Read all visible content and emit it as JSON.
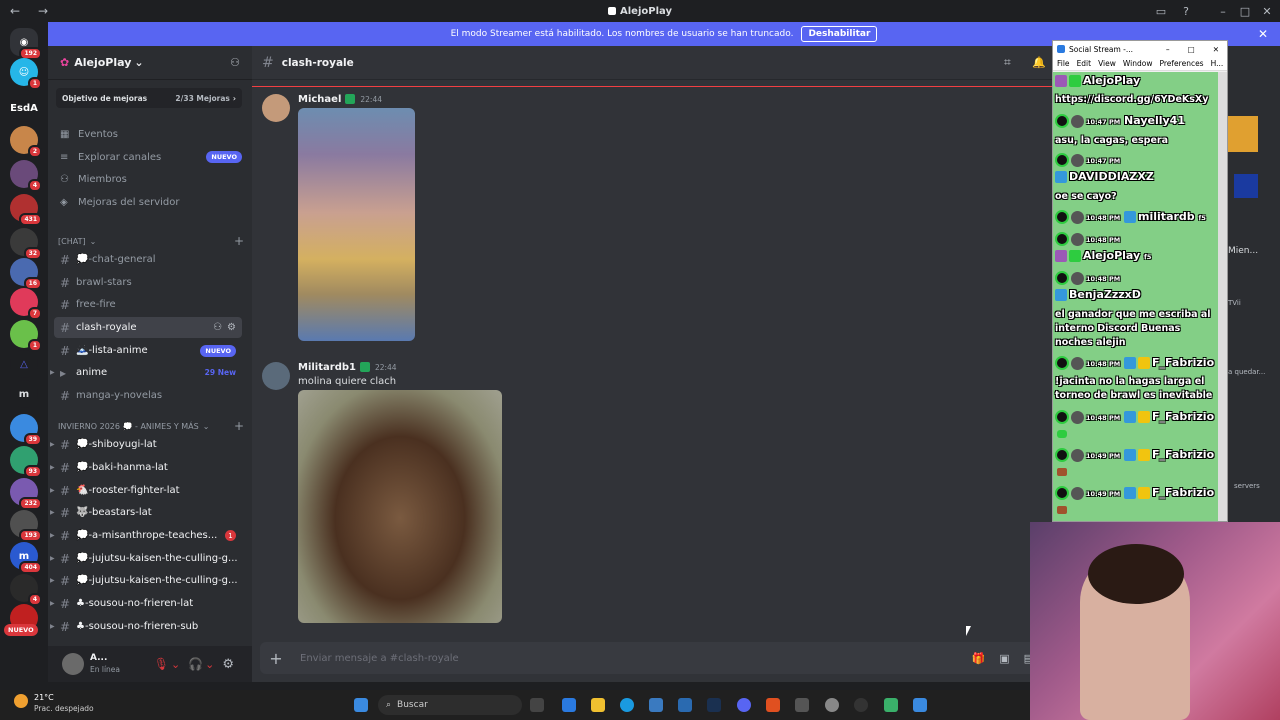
{
  "window": {
    "title": "AlejoPlay"
  },
  "banner": {
    "text": "El modo Streamer está habilitado. Los nombres de usuario se han truncado.",
    "button": "Deshabilitar"
  },
  "rail": {
    "badges": [
      "192",
      "1",
      "2",
      "4",
      "431",
      "32",
      "16",
      "7",
      "1",
      "39",
      "93",
      "232",
      "193",
      "404",
      "4"
    ],
    "esda": "EsdA",
    "m": "m",
    "nuevo": "NUEVO"
  },
  "guild": {
    "name": "AlejoPlay"
  },
  "boost": {
    "label": "Objetivo de mejoras",
    "count": "2/33 Mejoras"
  },
  "nav": [
    {
      "label": "Eventos"
    },
    {
      "label": "Explorar canales",
      "badge": "NUEVO"
    },
    {
      "label": "Miembros"
    },
    {
      "label": "Mejoras del servidor"
    }
  ],
  "categories": {
    "chat": "[CHAT]",
    "winter": "INVIERNO 2026 💭 - ANIMES Y MÁS"
  },
  "channels": [
    {
      "name": "💭-chat-general"
    },
    {
      "name": "brawl-stars"
    },
    {
      "name": "free-fire"
    },
    {
      "name": "clash-royale"
    },
    {
      "name": "🗻-lista-anime",
      "tag": "NUEVO"
    },
    {
      "name": "anime",
      "tag": "29 New"
    },
    {
      "name": "manga-y-novelas"
    },
    {
      "name": "💭-shiboyugi-lat"
    },
    {
      "name": "💭-baki-hanma-lat"
    },
    {
      "name": "🐔-rooster-fighter-lat"
    },
    {
      "name": "🐺-beastars-lat"
    },
    {
      "name": "💭-a-misanthrope-teaches...",
      "mention": "1"
    },
    {
      "name": "💭-jujutsu-kaisen-the-culling-g..."
    },
    {
      "name": "💭-jujutsu-kaisen-the-culling-g..."
    },
    {
      "name": "♣-sousou-no-frieren-lat"
    },
    {
      "name": "♣-sousou-no-frieren-sub"
    }
  ],
  "user": {
    "name": "A...",
    "status": "En línea"
  },
  "chat": {
    "channel": "clash-royale",
    "messages": [
      {
        "author": "Michael",
        "time": "22:44"
      },
      {
        "author": "Militardb1",
        "time": "22:44",
        "text": "molina quiere clach"
      }
    ],
    "composer_placeholder": "Enviar mensaje a #clash-royale"
  },
  "members_peek": {
    "a": "Mien...",
    "b": "TVii",
    "c": "a quedar...",
    "d": "servers"
  },
  "social": {
    "title": "Social Stream -...",
    "menu": [
      "File",
      "Edit",
      "View",
      "Window",
      "Preferences",
      "H..."
    ],
    "feed": [
      {
        "name": "AlejoPlay"
      },
      {
        "text": "https://discord.gg/6YDeKsXy"
      },
      {
        "time": "10:47 PM",
        "name": "Nayelly41"
      },
      {
        "text": "asu, la cagas, espera"
      },
      {
        "time": "10:47 PM"
      },
      {
        "name": "DAVIDDIAZXZ"
      },
      {
        "text": "oe se cayo?"
      },
      {
        "time": "10:48 PM",
        "name": "militardb",
        "badge": "f5"
      },
      {
        "time": "10:48 PM"
      },
      {
        "name": "AlejoPlay",
        "badge": "f5"
      },
      {
        "time": "10:48 PM"
      },
      {
        "name": "BenjaZzzxD"
      },
      {
        "text": "el ganador que me escriba al interno Discord Buenas noches alejin"
      },
      {
        "time": "10:48 PM",
        "name": "F_Fabrizio"
      },
      {
        "text": "!jacinta no la hagas larga el torneo de brawl es inevitable"
      },
      {
        "time": "10:48 PM",
        "name": "F_Fabrizio"
      },
      {
        "time": "10:49 PM",
        "name": "F_Fabrizio"
      },
      {
        "time": "10:49 PM",
        "name": "F_Fabrizio"
      }
    ]
  },
  "taskbar": {
    "temp": "21°C",
    "weather": "Prac. despejado",
    "search": "Buscar"
  }
}
